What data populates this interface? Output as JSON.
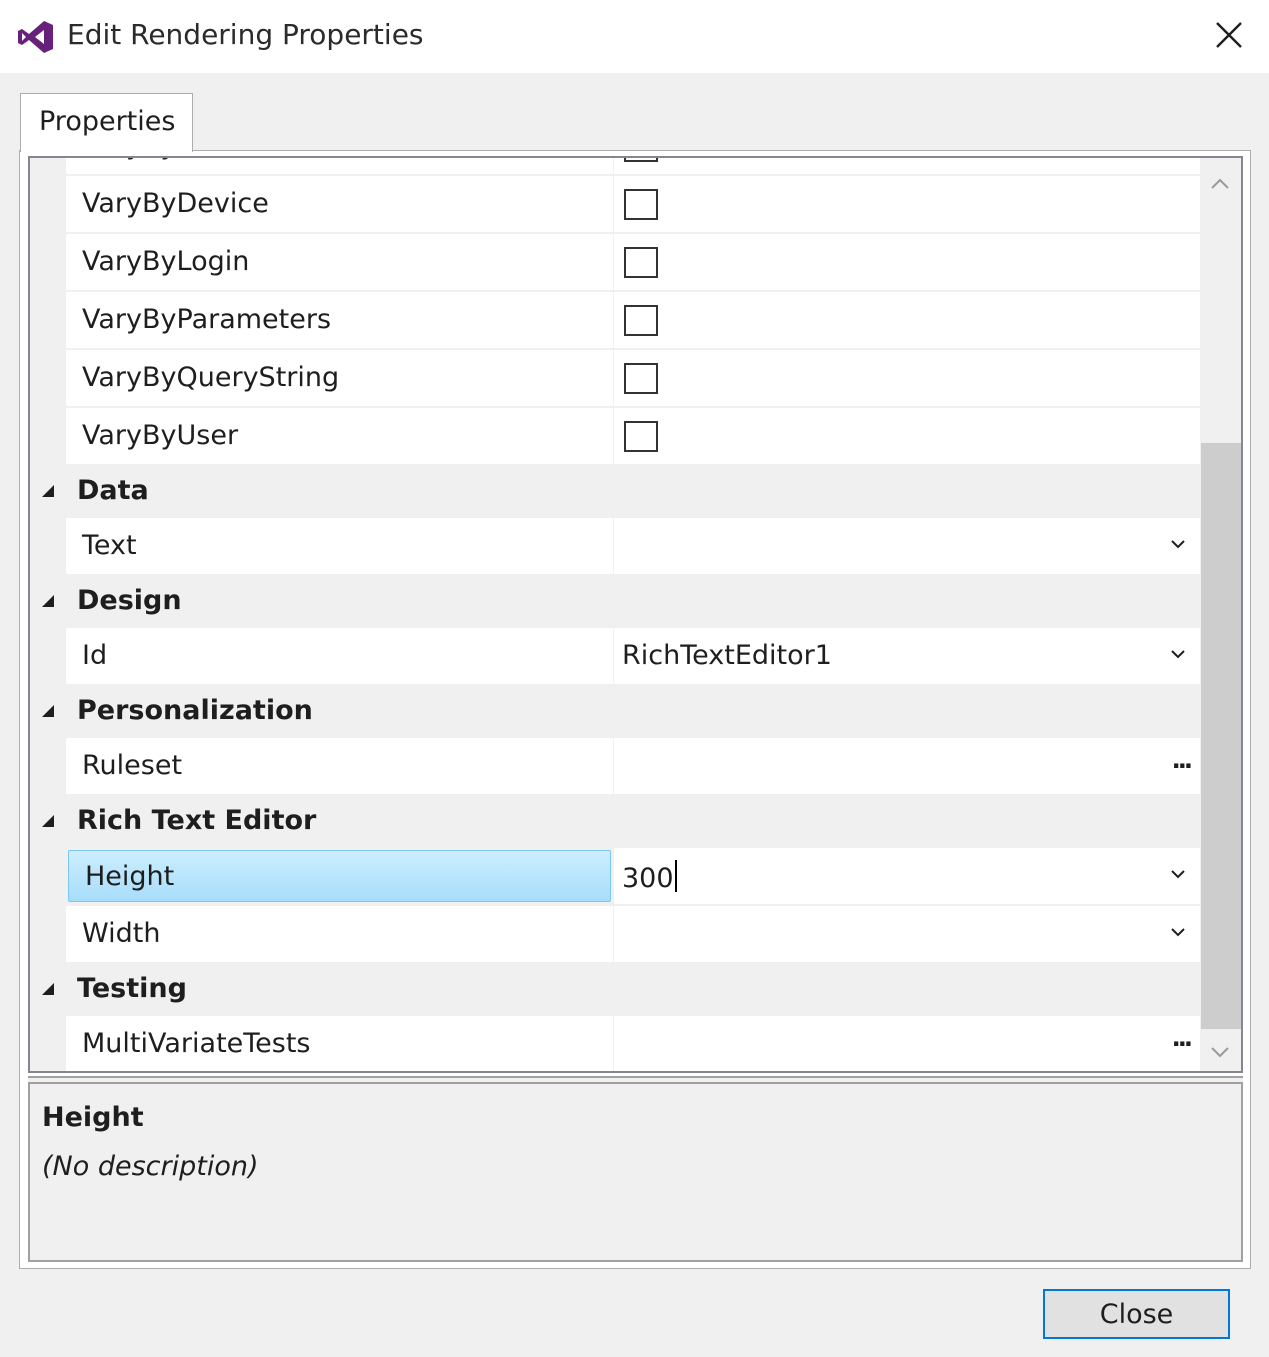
{
  "window": {
    "title": "Edit Rendering Properties",
    "close_icon": "close-icon",
    "app_icon": "visual-studio-logo",
    "accent_color": "#68217a"
  },
  "tabs": [
    {
      "label": "Properties",
      "active": true
    }
  ],
  "property_grid": {
    "partial_top_row": {
      "name": "VaryByData",
      "value_type": "checkbox",
      "checked": false
    },
    "rows_before_categories": [
      {
        "name": "VaryByDevice",
        "value_type": "checkbox",
        "checked": false
      },
      {
        "name": "VaryByLogin",
        "value_type": "checkbox",
        "checked": false
      },
      {
        "name": "VaryByParameters",
        "value_type": "checkbox",
        "checked": false
      },
      {
        "name": "VaryByQueryString",
        "value_type": "checkbox",
        "checked": false
      },
      {
        "name": "VaryByUser",
        "value_type": "checkbox",
        "checked": false
      }
    ],
    "categories": [
      {
        "label": "Data",
        "rows": [
          {
            "name": "Text",
            "value": "",
            "editor": "dropdown"
          }
        ]
      },
      {
        "label": "Design",
        "rows": [
          {
            "name": "Id",
            "value": "RichTextEditor1",
            "editor": "dropdown"
          }
        ]
      },
      {
        "label": "Personalization",
        "rows": [
          {
            "name": "Ruleset",
            "value": "",
            "editor": "ellipsis"
          }
        ]
      },
      {
        "label": "Rich Text Editor",
        "rows": [
          {
            "name": "Height",
            "value": "300",
            "editor": "dropdown",
            "selected": true
          },
          {
            "name": "Width",
            "value": "",
            "editor": "dropdown"
          }
        ]
      },
      {
        "label": "Testing",
        "rows": [
          {
            "name": "MultiVariateTests",
            "value": "",
            "editor": "ellipsis"
          }
        ]
      }
    ],
    "ellipsis_label": "..."
  },
  "description": {
    "title": "Height",
    "text": "(No description)"
  },
  "footer": {
    "close_label": "Close"
  },
  "colors": {
    "selection_fill": "#a8ddfa",
    "selection_border": "#7ac8f2",
    "default_button_border": "#0078d7"
  }
}
